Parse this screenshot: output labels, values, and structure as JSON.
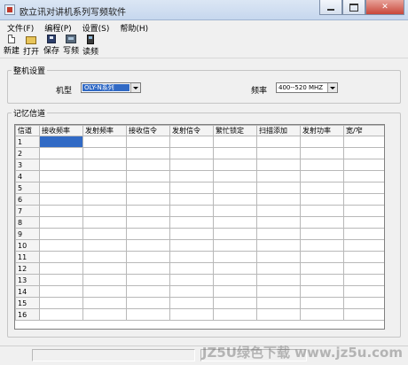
{
  "window": {
    "title": "欧立讯对讲机系列写频软件"
  },
  "menu": [
    "文件(F)",
    "编程(P)",
    "设置(S)",
    "帮助(H)"
  ],
  "toolbar": [
    {
      "label": "新建",
      "icon": "new-file-icon"
    },
    {
      "label": "打开",
      "icon": "open-folder-icon"
    },
    {
      "label": "保存",
      "icon": "save-disk-icon"
    },
    {
      "label": "写频",
      "icon": "write-radio-icon"
    },
    {
      "label": "读频",
      "icon": "read-radio-icon"
    }
  ],
  "settings": {
    "group_title": "整机设置",
    "model_label": "机型",
    "model_value": "OLY-N系列",
    "freq_label": "频率",
    "freq_value": "400--520 MHZ"
  },
  "channels": {
    "group_title": "记忆信道",
    "columns": [
      "信道",
      "接收频率",
      "发射频率",
      "接收信令",
      "发射信令",
      "繁忙锁定",
      "扫描添加",
      "发射功率",
      "宽/窄"
    ],
    "rows": [
      "1",
      "2",
      "3",
      "4",
      "5",
      "6",
      "7",
      "8",
      "9",
      "10",
      "11",
      "12",
      "13",
      "14",
      "15",
      "16"
    ]
  },
  "watermark": "JZ5U绿色下载 www.jz5u.com",
  "colors": {
    "selection": "#316ac5",
    "titlebar": "#c6d7ee"
  }
}
